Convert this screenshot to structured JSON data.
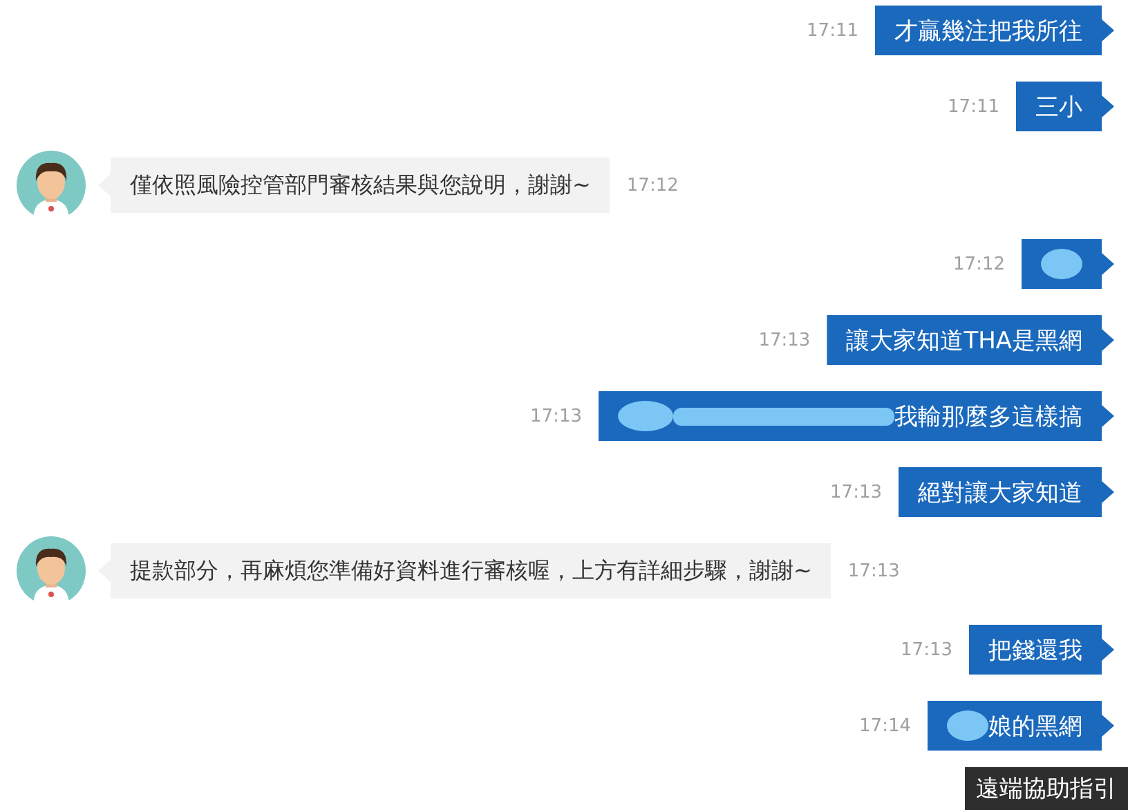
{
  "messages": [
    {
      "kind": "user",
      "text": "才贏幾注把我所往",
      "time": "17:11",
      "redacted": false
    },
    {
      "kind": "user",
      "text": "三小",
      "time": "17:11",
      "redacted": false
    },
    {
      "kind": "agent",
      "text": "僅依照風險控管部門審核結果與您說明，謝謝~",
      "time": "17:12"
    },
    {
      "kind": "user",
      "time": "17:12",
      "redacted": true
    },
    {
      "kind": "user",
      "text": "讓大家知道THA是黑網",
      "time": "17:13",
      "redacted": false
    },
    {
      "kind": "user_wide_redaction",
      "text": "我輸那麼多這樣搞",
      "time": "17:13",
      "redacted": true
    },
    {
      "kind": "user",
      "text": "絕對讓大家知道",
      "time": "17:13",
      "redacted": false
    },
    {
      "kind": "agent",
      "text": "提款部分，再麻煩您準備好資料進行審核喔，上方有詳細步驟，謝謝~",
      "time": "17:13"
    },
    {
      "kind": "user",
      "text": "把錢還我",
      "time": "17:13",
      "redacted": false
    },
    {
      "kind": "user",
      "text": "娘的黑網",
      "time": "17:14",
      "redacted": true
    }
  ],
  "help_button": "遠端協助指引"
}
